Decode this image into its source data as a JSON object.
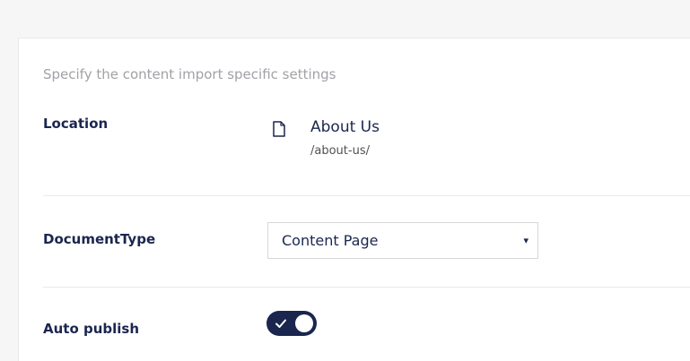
{
  "panel": {
    "description": "Specify the content import specific settings"
  },
  "location": {
    "label": "Location",
    "icon": "document-icon",
    "node_name": "About Us",
    "node_path": "/about-us/"
  },
  "document_type": {
    "label": "DocumentType",
    "selected": "Content Page",
    "caret": "▾"
  },
  "auto_publish": {
    "label": "Auto publish",
    "enabled": true
  },
  "colors": {
    "text_primary": "#1b264f",
    "text_muted": "#a2a1a6",
    "toggle_on": "#1b264f",
    "background": "#f6f6f7"
  }
}
